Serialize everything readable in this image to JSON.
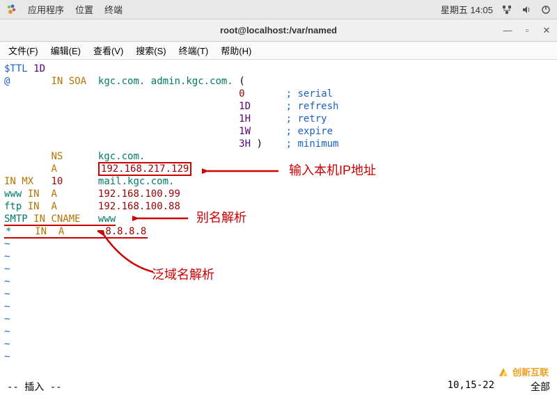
{
  "taskbar": {
    "apps": "应用程序",
    "places": "位置",
    "terminal": "终端",
    "clock": "星期五 14:05"
  },
  "window": {
    "title": "root@localhost:/var/named"
  },
  "menus": {
    "file": "文件(F)",
    "edit": "编辑(E)",
    "view": "查看(V)",
    "search": "搜索(S)",
    "terminal": "终端(T)",
    "help": "帮助(H)"
  },
  "zone": {
    "ttl_key": "$TTL",
    "ttl_val": "1D",
    "at": "@",
    "in": "IN",
    "soa": "SOA",
    "soa_ns": "kgc.com.",
    "soa_mail": "admin.kgc.com.",
    "soa_open": "(",
    "serial_v": "0",
    "serial_k": "serial",
    "refresh_v": "1D",
    "refresh_k": "refresh",
    "retry_v": "1H",
    "retry_k": "retry",
    "expire_v": "1W",
    "expire_k": "expire",
    "min_v": "3H",
    "min_k": "minimum",
    "close_paren": ")",
    "ns_type": "NS",
    "ns_val": "kgc.com.",
    "a_type": "A",
    "a_val": "192.168.217.129",
    "mx_type": "MX",
    "mx_pri": "10",
    "mx_val": "mail.kgc.com.",
    "www_name": "www",
    "www_in": "IN",
    "www_type": "A",
    "www_val": "192.168.100.99",
    "ftp_name": "ftp",
    "ftp_in": "IN",
    "ftp_type": "A",
    "ftp_val": "192.168.100.88",
    "smtp_name": "SMTP",
    "smtp_in": "IN",
    "smtp_type": "CNAME",
    "smtp_val": "www",
    "star_name": "*",
    "star_in": "IN",
    "star_type": "A",
    "star_val": "8.8.8.8",
    "semi": ";"
  },
  "annotations": {
    "ip_label": "输入本机IP地址",
    "alias_label": "别名解析",
    "wildcard_label": "泛域名解析"
  },
  "status": {
    "mode": "-- 插入 --",
    "pos": "10,15-22",
    "scroll": "全部"
  },
  "watermark": "创新互联"
}
